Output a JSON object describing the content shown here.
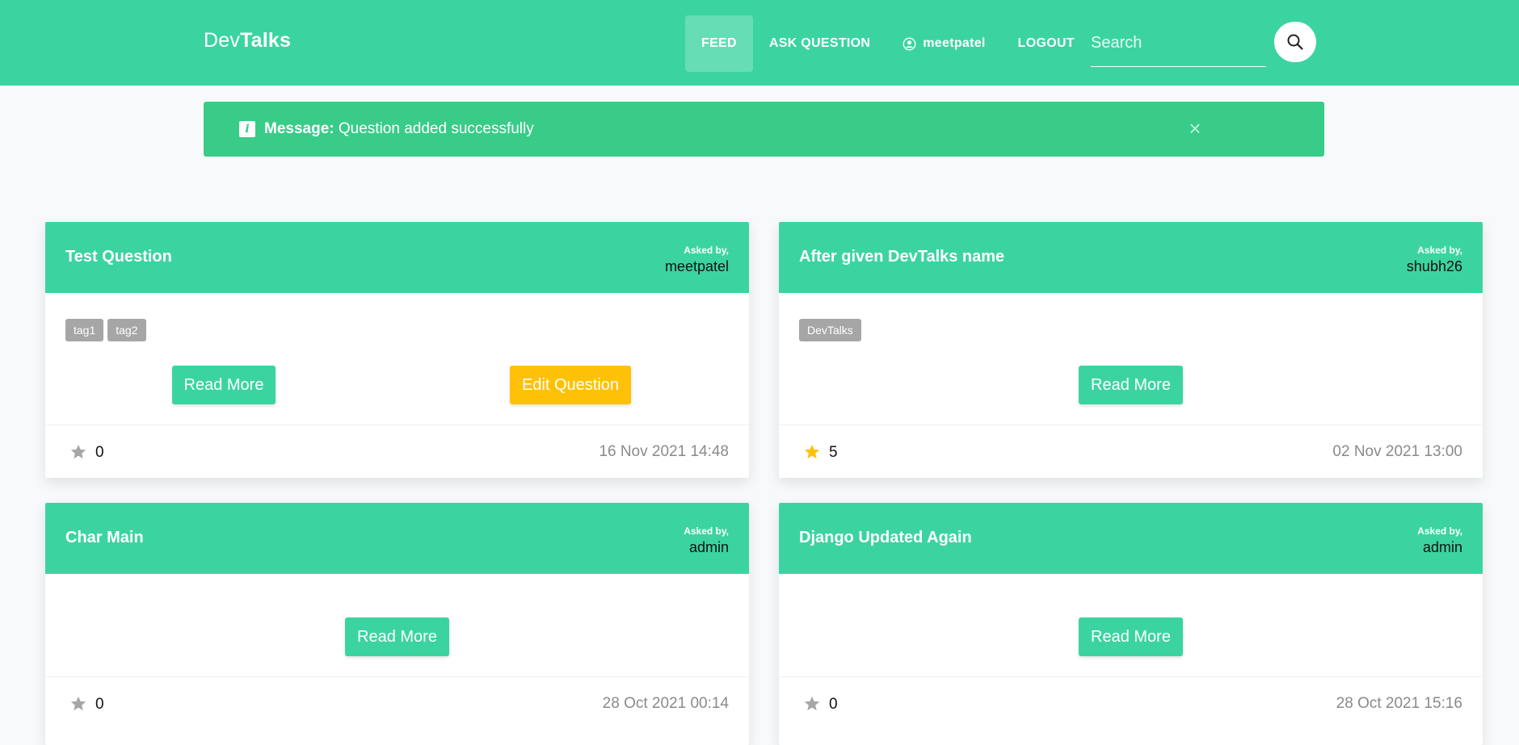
{
  "nav": {
    "brand_part1": "Dev",
    "brand_part2": "Talks",
    "feed": "FEED",
    "ask_question": "ASK QUESTION",
    "username": "meetpatel",
    "logout": "LOGOUT",
    "search_placeholder": "Search"
  },
  "alert": {
    "label": "Message:",
    "text": " Question added successfully",
    "close": "×"
  },
  "cards": [
    {
      "title": "Test Question",
      "asked_label": "Asked by,",
      "asked_by": "meetpatel",
      "tags": [
        "tag1",
        "tag2"
      ],
      "read_more": "Read More",
      "edit": "Edit Question",
      "likes": "0",
      "starred": false,
      "date": "16 Nov 2021 14:48"
    },
    {
      "title": "After given DevTalks name",
      "asked_label": "Asked by,",
      "asked_by": "shubh26",
      "tags": [
        "DevTalks"
      ],
      "read_more": "Read More",
      "likes": "5",
      "starred": true,
      "date": "02 Nov 2021 13:00"
    },
    {
      "title": "Char Main",
      "asked_label": "Asked by,",
      "asked_by": "admin",
      "tags": [],
      "read_more": "Read More",
      "likes": "0",
      "starred": false,
      "date": "28 Oct 2021 00:14"
    },
    {
      "title": "Django Updated Again",
      "asked_label": "Asked by,",
      "asked_by": "admin",
      "tags": [],
      "read_more": "Read More",
      "likes": "0",
      "starred": false,
      "date": "28 Oct 2021 15:16"
    }
  ],
  "colors": {
    "primary": "#3bd4a0",
    "alert": "#38cc88",
    "edit": "#ffc107",
    "star_active": "#ffc107",
    "star_inactive": "#a6a6a6"
  }
}
